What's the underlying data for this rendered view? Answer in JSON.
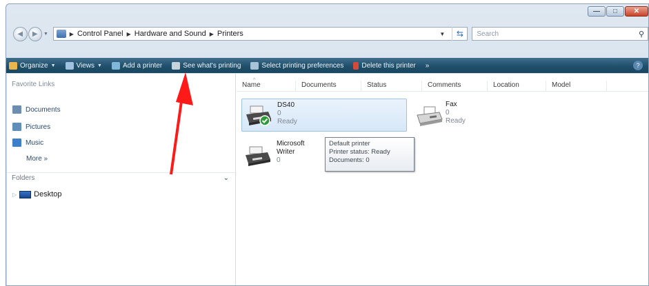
{
  "window": {
    "caption_buttons": {
      "minimize": "—",
      "maximize": "□",
      "close": "✕"
    }
  },
  "address": {
    "back_glyph": "◀",
    "forward_glyph": "▶",
    "breadcrumbs": [
      "Control Panel",
      "Hardware and Sound",
      "Printers"
    ],
    "search_placeholder": "Search"
  },
  "toolbar": {
    "items": [
      {
        "label": "Organize",
        "icon": "organize-icon",
        "has_dropdown": true,
        "color": "#e8b64a"
      },
      {
        "label": "Views",
        "icon": "views-icon",
        "has_dropdown": true,
        "color": "#9fc2e0"
      },
      {
        "label": "Add a printer",
        "icon": "add-printer-icon",
        "has_dropdown": false,
        "color": "#7fb8d8"
      },
      {
        "label": "See what's printing",
        "icon": "print-queue-icon",
        "has_dropdown": false,
        "color": "#c8d4dc"
      },
      {
        "label": "Select printing preferences",
        "icon": "preferences-icon",
        "has_dropdown": false,
        "color": "#a8c3d8"
      },
      {
        "label": "Delete this printer",
        "icon": "delete-icon",
        "has_dropdown": false,
        "color": "#d64a3a"
      }
    ],
    "overflow": "»",
    "help_glyph": "?"
  },
  "navigation": {
    "favorites_title": "Favorite Links",
    "favorites": [
      {
        "label": "Documents",
        "icon": "documents-icon",
        "color": "#6d8eb0"
      },
      {
        "label": "Pictures",
        "icon": "pictures-icon",
        "color": "#5f8fb8"
      },
      {
        "label": "Music",
        "icon": "music-icon",
        "color": "#3d7fc8"
      }
    ],
    "more_label": "More »",
    "folders_label": "Folders",
    "tree": [
      {
        "label": "Desktop",
        "icon": "desktop-icon"
      }
    ]
  },
  "list": {
    "columns": [
      "Name",
      "Documents",
      "Status",
      "Comments",
      "Location",
      "Model"
    ],
    "printers": [
      {
        "name": "DS40",
        "documents": "0",
        "status": "Ready",
        "default": true,
        "selected": true,
        "icon": "printer-icon"
      },
      {
        "name": "Fax",
        "documents": "0",
        "status": "Ready",
        "default": false,
        "selected": false,
        "icon": "fax-icon"
      },
      {
        "name": "Microsoft",
        "name_line2": "Writer",
        "documents": "0",
        "status": "",
        "default": false,
        "selected": false,
        "icon": "printer-icon"
      }
    ],
    "tooltip": {
      "line1": "Default printer",
      "line2": "Printer status: Ready",
      "line3": "Documents: 0"
    }
  },
  "annotation": {
    "color": "#ff1a1a"
  }
}
